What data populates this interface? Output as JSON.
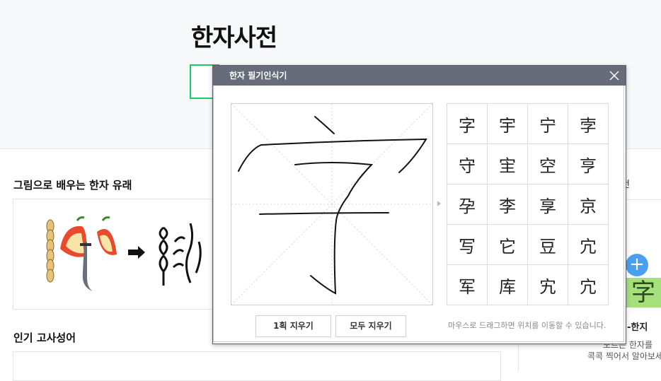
{
  "page": {
    "title": "한자사전"
  },
  "sections": {
    "origin_title": "그림으로 배우는 한자 유래",
    "proverb_title": "인기 고사성어"
  },
  "right_panel": {
    "tab_fragment": "전",
    "promo_plus": "+",
    "promo_char": "字",
    "promo_title": "미-한지",
    "promo_line1": "모르는 한자를",
    "promo_line2": "콕콕 찍어서 알아보세요"
  },
  "popup": {
    "title": "한자 필기인식기",
    "clear_one_label": "1획 지우기",
    "clear_all_label": "모두 지우기",
    "hint": "마우스로 드래그하면 위치를 이동할 수 있습니다.",
    "candidates": [
      [
        "字",
        "宇",
        "宁",
        "孛"
      ],
      [
        "守",
        "宔",
        "空",
        "亨"
      ],
      [
        "孕",
        "李",
        "享",
        "京"
      ],
      [
        "写",
        "它",
        "豆",
        "宂"
      ],
      [
        "军",
        "库",
        "宄",
        "宂"
      ]
    ]
  },
  "icons": {
    "close": "close-icon",
    "arrow": "chevron-right-icon"
  },
  "colors": {
    "accent": "#19ce60",
    "header_bar": "#676c7a",
    "promo_blue": "#4aa0f0",
    "promo_green": "#a6e07d"
  }
}
